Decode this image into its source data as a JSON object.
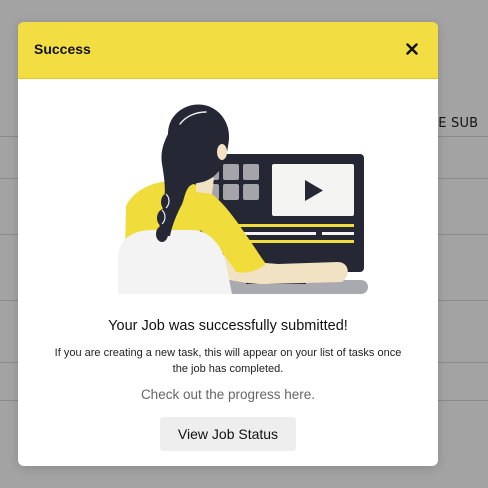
{
  "background": {
    "column_header": "ATIE SUB"
  },
  "modal": {
    "title": "Success",
    "header_color": "#f2dd42",
    "close_icon": "close-icon",
    "illustration": "person-watching-video-illustration",
    "headline": "Your Job was successfully submitted!",
    "description_line1": "If you are creating a new task, this will appear on your list of tasks once",
    "description_line2": "the job has completed.",
    "progress_text": "Check out the progress here.",
    "button_label": "View Job Status"
  },
  "colors": {
    "accent_yellow": "#f2dd42",
    "illustration_yellow": "#f0dc3a",
    "illustration_dark": "#252834",
    "overlay": "rgba(0,0,0,0.36)"
  }
}
